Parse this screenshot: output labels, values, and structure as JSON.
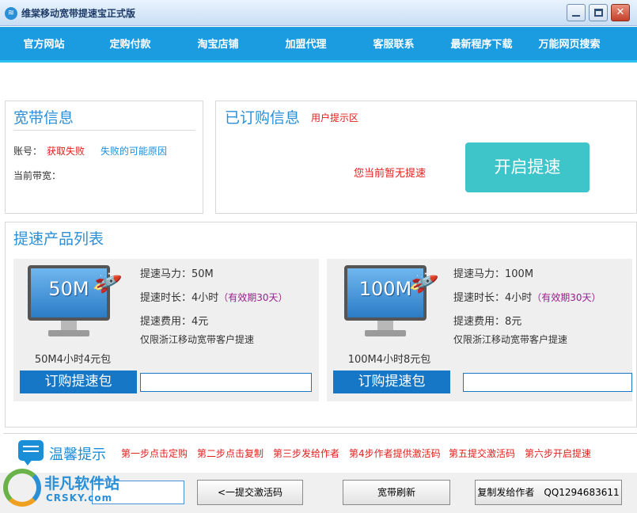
{
  "window": {
    "title": "维棠移动宽带提速宝正式版",
    "icon": "wifi-app-icon",
    "controls": {
      "minimize": "minimize-icon",
      "maximize": "maximize-icon",
      "close": "close-icon"
    }
  },
  "nav": {
    "items": [
      "官方网站",
      "定购付款",
      "淘宝店铺",
      "加盟代理",
      "客服联系",
      "最新程序下载",
      "万能网页搜索"
    ]
  },
  "broadband": {
    "title": "宽带信息",
    "account_label": "账号：",
    "account_value": "获取失败",
    "fail_reason_link": "失败的可能原因",
    "bandwidth_label": "当前带宽："
  },
  "subscription": {
    "title": "已订购信息",
    "hint": "用户提示区",
    "status": "您当前暂无提速",
    "speedup_button": "开启提速"
  },
  "products": {
    "title": "提速产品列表",
    "items": [
      {
        "screen_label": "50M",
        "name": "50M4小时4元包",
        "horsepower": "提速马力：50M",
        "duration": "提速时长：4小时",
        "validity": "（有效期30天）",
        "fee": "提速费用：4元",
        "restriction": "仅限浙江移动宽带客户提速",
        "order_button": "订购提速包"
      },
      {
        "screen_label": "100M",
        "name": "100M4小时8元包",
        "horsepower": "提速马力：100M",
        "duration": "提速时长：4小时",
        "validity": "（有效期30天）",
        "fee": "提速费用：8元",
        "restriction": "仅限浙江移动宽带客户提速",
        "order_button": "订购提速包"
      }
    ]
  },
  "tips": {
    "title": "温馨提示",
    "steps": [
      "第一步点击定购",
      "第二步点击复制",
      "第三步发给作者",
      "第4步作者提供激活码",
      "第五提交激活码",
      "第六步开启提速"
    ]
  },
  "bottom": {
    "submit_button": "<一提交激活码",
    "refresh_button": "宽带刷新",
    "copy_button": "复制发给作者　QQ1294683611"
  },
  "watermark": {
    "name": "非凡软件站",
    "domain": "CRSKY.com"
  },
  "colors": {
    "nav_bg": "#1b9be0",
    "accent_blue": "#2a8fd6",
    "speedup_button": "#3ec5c9",
    "order_button": "#1677c6",
    "warning_red": "#e0201c"
  }
}
